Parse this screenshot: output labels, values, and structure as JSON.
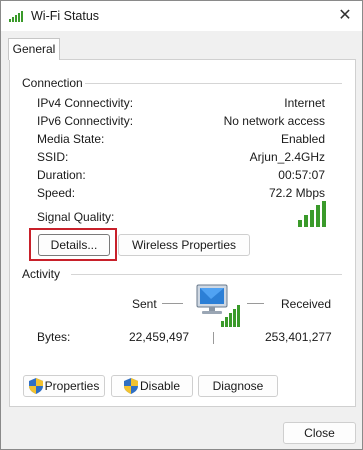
{
  "window": {
    "title": "Wi-Fi Status",
    "close_glyph": "✕"
  },
  "tabs": [
    {
      "label": "General"
    }
  ],
  "connection": {
    "heading": "Connection",
    "rows": [
      {
        "label": "IPv4 Connectivity:",
        "value": "Internet"
      },
      {
        "label": "IPv6 Connectivity:",
        "value": "No network access"
      },
      {
        "label": "Media State:",
        "value": "Enabled"
      },
      {
        "label": "SSID:",
        "value": "Arjun_2.4GHz"
      },
      {
        "label": "Duration:",
        "value": "00:57:07"
      },
      {
        "label": "Speed:",
        "value": "72.2 Mbps"
      }
    ],
    "signal_label": "Signal Quality:",
    "signal_bars_active": 5,
    "signal_bars_total": 5
  },
  "buttons": {
    "details": "Details...",
    "wireless_properties": "Wireless Properties",
    "properties": "Properties",
    "disable": "Disable",
    "diagnose": "Diagnose",
    "close": "Close"
  },
  "activity": {
    "heading": "Activity",
    "sent_label": "Sent",
    "received_label": "Received",
    "bytes_label": "Bytes:",
    "bytes_sent": "22,459,497",
    "bytes_received": "253,401,277"
  },
  "colors": {
    "signal_green": "#3a9a2a",
    "highlight_red": "#c8202a",
    "shield_blue": "#2f6fc4",
    "shield_yellow": "#f2c230"
  },
  "icons": {
    "title": "wifi-signal-icon",
    "activity": "network-computer-icon",
    "shield": "uac-shield-icon"
  }
}
